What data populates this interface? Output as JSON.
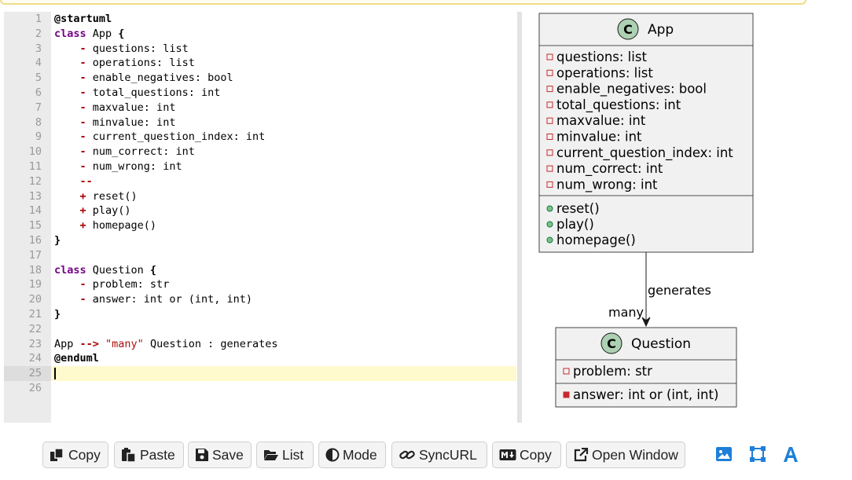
{
  "editor": {
    "lines": [
      {
        "n": "1",
        "parts": [
          [
            "kw2",
            "@startuml"
          ]
        ]
      },
      {
        "n": "2",
        "parts": [
          [
            "kw",
            "class"
          ],
          [
            "",
            " App "
          ],
          [
            "kw2",
            "{"
          ]
        ]
      },
      {
        "n": "3",
        "parts": [
          [
            "",
            "    "
          ],
          [
            "op",
            "-"
          ],
          [
            "",
            " questions: list"
          ]
        ]
      },
      {
        "n": "4",
        "parts": [
          [
            "",
            "    "
          ],
          [
            "op",
            "-"
          ],
          [
            "",
            " operations: list"
          ]
        ]
      },
      {
        "n": "5",
        "parts": [
          [
            "",
            "    "
          ],
          [
            "op",
            "-"
          ],
          [
            "",
            " enable_negatives: bool"
          ]
        ]
      },
      {
        "n": "6",
        "parts": [
          [
            "",
            "    "
          ],
          [
            "op",
            "-"
          ],
          [
            "",
            " total_questions: int"
          ]
        ]
      },
      {
        "n": "7",
        "parts": [
          [
            "",
            "    "
          ],
          [
            "op",
            "-"
          ],
          [
            "",
            " maxvalue: int"
          ]
        ]
      },
      {
        "n": "8",
        "parts": [
          [
            "",
            "    "
          ],
          [
            "op",
            "-"
          ],
          [
            "",
            " minvalue: int"
          ]
        ]
      },
      {
        "n": "9",
        "parts": [
          [
            "",
            "    "
          ],
          [
            "op",
            "-"
          ],
          [
            "",
            " current_question_index: int"
          ]
        ]
      },
      {
        "n": "10",
        "parts": [
          [
            "",
            "    "
          ],
          [
            "op",
            "-"
          ],
          [
            "",
            " num_correct: int"
          ]
        ]
      },
      {
        "n": "11",
        "parts": [
          [
            "",
            "    "
          ],
          [
            "op",
            "-"
          ],
          [
            "",
            " num_wrong: int"
          ]
        ]
      },
      {
        "n": "12",
        "parts": [
          [
            "",
            "    "
          ],
          [
            "op",
            "--"
          ]
        ]
      },
      {
        "n": "13",
        "parts": [
          [
            "",
            "    "
          ],
          [
            "op",
            "+"
          ],
          [
            "",
            " reset()"
          ]
        ]
      },
      {
        "n": "14",
        "parts": [
          [
            "",
            "    "
          ],
          [
            "op",
            "+"
          ],
          [
            "",
            " play()"
          ]
        ]
      },
      {
        "n": "15",
        "parts": [
          [
            "",
            "    "
          ],
          [
            "op",
            "+"
          ],
          [
            "",
            " homepage()"
          ]
        ]
      },
      {
        "n": "16",
        "parts": [
          [
            "kw2",
            "}"
          ]
        ]
      },
      {
        "n": "17",
        "parts": []
      },
      {
        "n": "18",
        "parts": [
          [
            "kw",
            "class"
          ],
          [
            "",
            " Question "
          ],
          [
            "kw2",
            "{"
          ]
        ]
      },
      {
        "n": "19",
        "parts": [
          [
            "",
            "    "
          ],
          [
            "op",
            "-"
          ],
          [
            "",
            " problem: str"
          ]
        ]
      },
      {
        "n": "20",
        "parts": [
          [
            "",
            "    "
          ],
          [
            "op",
            "-"
          ],
          [
            "",
            " answer: int or (int, int)"
          ]
        ]
      },
      {
        "n": "21",
        "parts": [
          [
            "kw2",
            "}"
          ]
        ]
      },
      {
        "n": "22",
        "parts": []
      },
      {
        "n": "23",
        "parts": [
          [
            "",
            "App "
          ],
          [
            "op",
            "-->"
          ],
          [
            "",
            " "
          ],
          [
            "str",
            "\"many\""
          ],
          [
            "",
            " Question : generates"
          ]
        ]
      },
      {
        "n": "24",
        "parts": [
          [
            "kw2",
            "@enduml"
          ]
        ]
      },
      {
        "n": "25",
        "parts": [],
        "active": true
      },
      {
        "n": "26",
        "parts": []
      }
    ]
  },
  "diagram": {
    "app": {
      "stereotype": "C",
      "name": "App",
      "fields": [
        "questions: list",
        "operations: list",
        "enable_negatives: bool",
        "total_questions: int",
        "maxvalue: int",
        "minvalue: int",
        "current_question_index: int",
        "num_correct: int",
        "num_wrong: int"
      ],
      "methods": [
        "reset()",
        "play()",
        "homepage()"
      ]
    },
    "question": {
      "stereotype": "C",
      "name": "Question",
      "fields": [
        "problem: str"
      ],
      "fields2": [
        "answer: int or (int, int)"
      ]
    },
    "relation": {
      "label": "generates",
      "multiplicity": "many"
    },
    "colors": {
      "box_fill": "#f1f1f1",
      "box_stroke": "#181818",
      "circle_fill": "#add1b2",
      "private_marker": "#c82930",
      "public_marker": "#84be84"
    }
  },
  "toolbar": {
    "copy": "Copy",
    "paste": "Paste",
    "save": "Save",
    "list": "List",
    "mode": "Mode",
    "syncurl": "SyncURL",
    "md_copy": "Copy",
    "open_window": "Open Window"
  },
  "icons": {
    "image": "image-icon",
    "resize": "resize-icon",
    "font": "font-icon"
  }
}
